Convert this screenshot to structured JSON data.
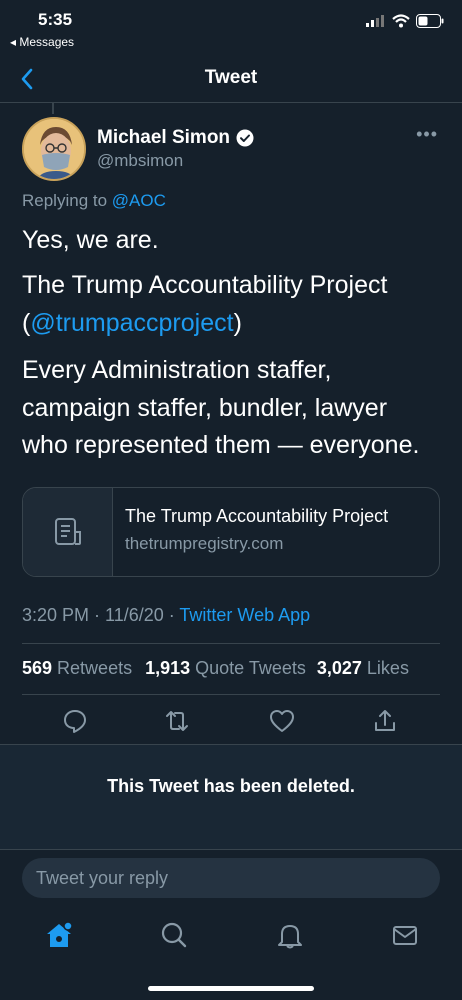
{
  "status_bar": {
    "time": "5:35",
    "back_app": "◂ Messages"
  },
  "nav": {
    "title": "Tweet"
  },
  "tweet": {
    "author_name": "Michael Simon",
    "author_handle": "@mbsimon",
    "replying_prefix": "Replying to ",
    "replying_to": "@AOC",
    "line1": "Yes, we are.",
    "line2a": "The Trump Accountability Project",
    "line2b_open": "(",
    "line2b_link": "@trumpaccproject",
    "line2b_close": ")",
    "line3a": "Every Administration staffer,",
    "line3b": "campaign staffer, bundler, lawyer",
    "line3c": "who represented them — everyone.",
    "card_title": "The Trump Accountability Project",
    "card_domain": "thetrumpregistry.com",
    "timestamp": "3:20 PM · 11/6/20 · ",
    "source": "Twitter Web App",
    "retweets_count": "569",
    "retweets_label": " Retweets",
    "quotes_count": "1,913",
    "quotes_label": " Quote Tweets",
    "likes_count": "3,027",
    "likes_label": " Likes"
  },
  "deleted_notice": "This Tweet has been deleted.",
  "reply": {
    "placeholder": "Tweet your reply"
  },
  "colors": {
    "background": "#15202b",
    "accent": "#1d9bf0",
    "secondary_text": "#8899a6",
    "divider": "#38444d"
  }
}
